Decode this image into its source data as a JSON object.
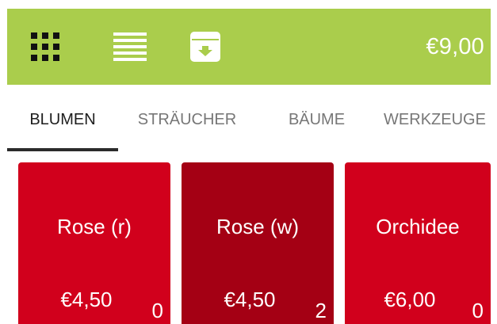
{
  "colors": {
    "topbar": "#aacd4c",
    "tile_red": "#d1001c",
    "tile_dark_red": "#a40014",
    "tab_active": "#1e1e1e",
    "tab_inactive": "#777777"
  },
  "toolbar": {
    "icons": [
      "grid-view-icon",
      "list-view-icon",
      "archive-download-icon"
    ],
    "total": "€9,00"
  },
  "tabs": [
    {
      "label": "BLUMEN",
      "active": true
    },
    {
      "label": "STRÄUCHER",
      "active": false
    },
    {
      "label": "BÄUME",
      "active": false
    },
    {
      "label": "WERKZEUGE",
      "active": false
    }
  ],
  "products": [
    {
      "name": "Rose (r)",
      "price": "€4,50",
      "count": "0"
    },
    {
      "name": "Rose (w)",
      "price": "€4,50",
      "count": "2"
    },
    {
      "name": "Orchidee",
      "price": "€6,00",
      "count": "0"
    }
  ]
}
